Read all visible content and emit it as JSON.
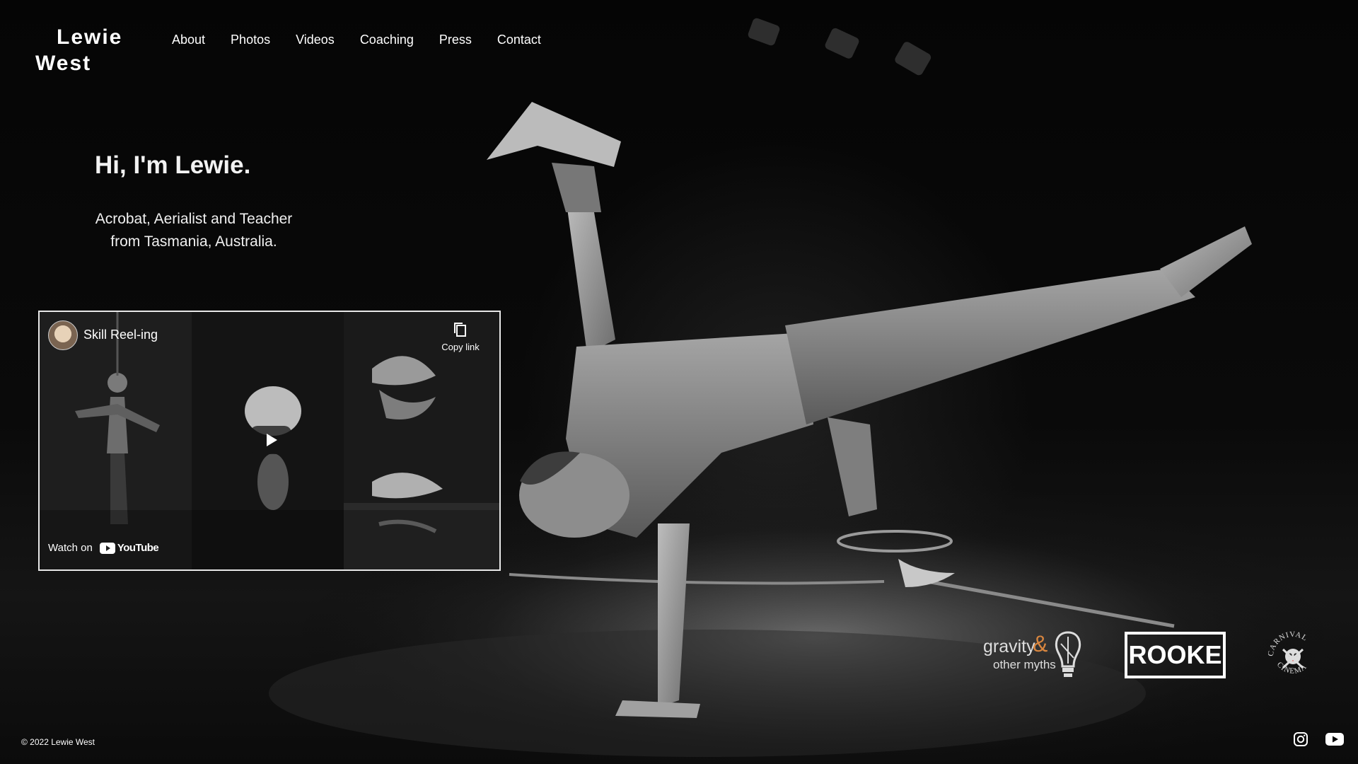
{
  "brand": {
    "name_line1": "Lewie",
    "name_line2": "West"
  },
  "nav": {
    "items": [
      {
        "label": "About"
      },
      {
        "label": "Photos"
      },
      {
        "label": "Videos"
      },
      {
        "label": "Coaching"
      },
      {
        "label": "Press"
      },
      {
        "label": "Contact"
      }
    ]
  },
  "hero": {
    "title": "Hi, I'm Lewie.",
    "subtitle_line1": "Acrobat, Aerialist and Teacher",
    "subtitle_line2": "from Tasmania, Australia."
  },
  "video": {
    "title": "Skill Reel-ing",
    "copy_link_label": "Copy link",
    "watch_on_label": "Watch on",
    "platform_label": "YouTube"
  },
  "sponsors": {
    "gravity_word": "gravity",
    "gravity_amp": "&",
    "gravity_sub": "other myths",
    "rooke": "ROOKE",
    "carnival_top": "CARNIVAL",
    "carnival_bottom": "CINEMA"
  },
  "footer": {
    "copyright": "© 2022 Lewie West"
  },
  "social": {
    "icons": [
      "instagram-icon",
      "youtube-icon"
    ]
  },
  "colors": {
    "background": "#000000",
    "text": "#ffffff",
    "gravity_accent": "#d9863f",
    "youtube_red": "#ff0000"
  }
}
